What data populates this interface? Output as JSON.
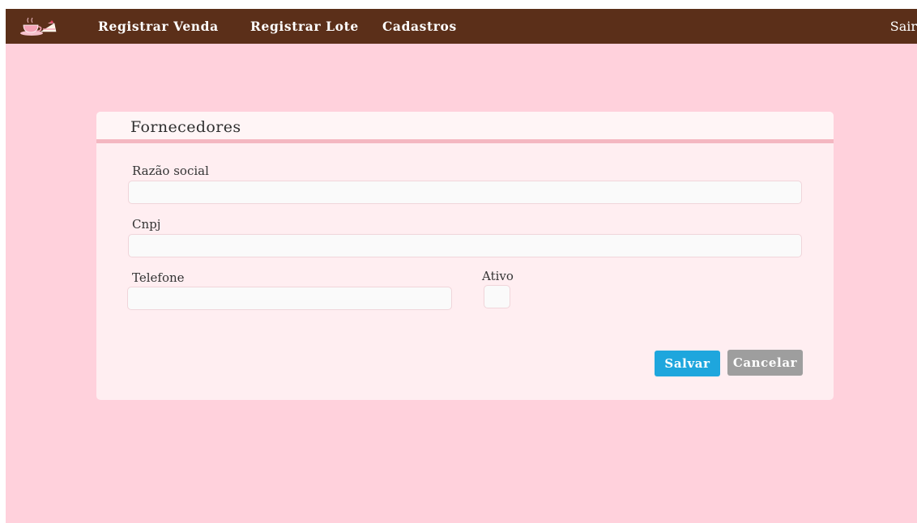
{
  "navbar": {
    "logo_icon": "tea-and-cake-logo-icon",
    "links": [
      "Registrar Venda",
      "Registrar Lote",
      "Cadastros"
    ],
    "logout": "Sair",
    "background": "#5b2f19"
  },
  "form": {
    "title": "Fornecedores",
    "fields": {
      "razao_social": {
        "label": "Razão social",
        "value": ""
      },
      "cnpj": {
        "label": "Cnpj",
        "value": ""
      },
      "telefone": {
        "label": "Telefone",
        "value": ""
      },
      "ativo": {
        "label": "Ativo",
        "checked": false
      }
    },
    "buttons": {
      "save": "Salvar",
      "cancel": "Cancelar"
    }
  },
  "colors": {
    "page_background": "#ffd1dc",
    "card_background": "#ffeef1",
    "header_rule": "#f4b7c1",
    "save_button": "#1ea6dd",
    "cancel_button": "#9e9e9e"
  }
}
